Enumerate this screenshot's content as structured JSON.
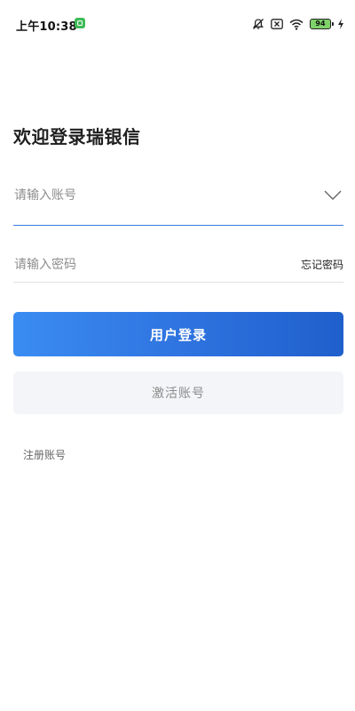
{
  "status_bar": {
    "time": "上午10:38",
    "battery_level": "94"
  },
  "page": {
    "title": "欢迎登录瑞银信"
  },
  "form": {
    "account_placeholder": "请输入账号",
    "password_placeholder": "请输入密码",
    "forgot_password": "忘记密码"
  },
  "actions": {
    "login_label": "用户登录",
    "activate_label": "激活账号",
    "register_label": "注册账号"
  },
  "colors": {
    "primary": "#2f74e0",
    "secondary_bg": "#f4f5f8",
    "battery": "#7ed26a"
  }
}
